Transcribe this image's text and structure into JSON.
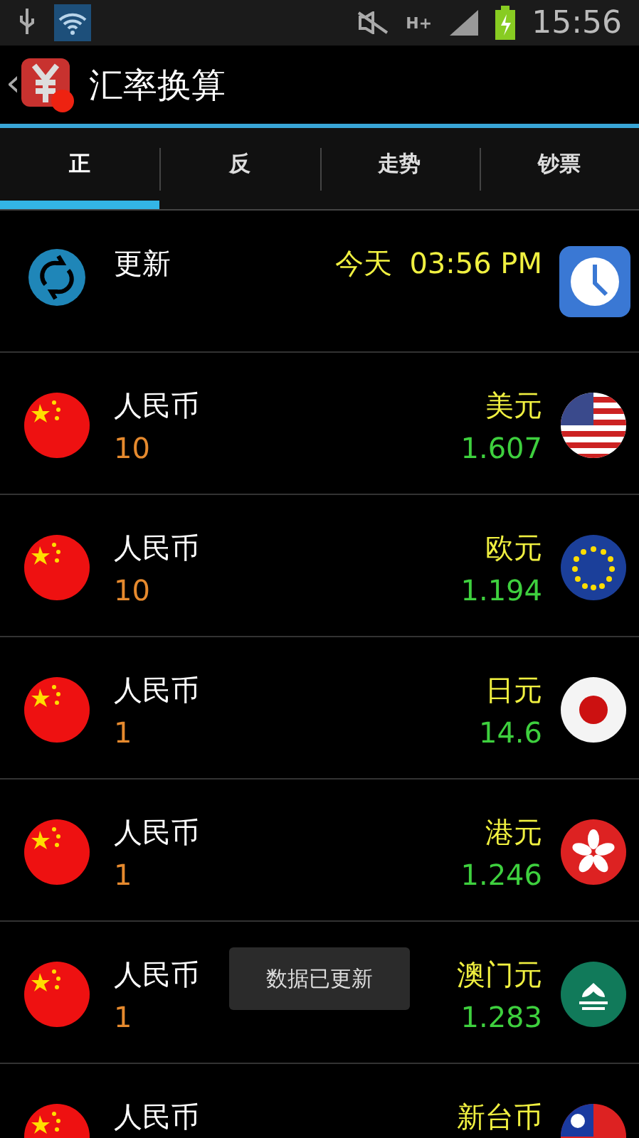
{
  "status_bar": {
    "time": "15:56",
    "network": "H+"
  },
  "action_bar": {
    "back": "‹",
    "title": "汇率换算"
  },
  "tabs": [
    {
      "label": "正",
      "selected": true
    },
    {
      "label": "反",
      "selected": false
    },
    {
      "label": "走势",
      "selected": false
    },
    {
      "label": "钞票",
      "selected": false
    }
  ],
  "update_row": {
    "label": "更新",
    "day": "今天",
    "time": "03:56 PM"
  },
  "rates": [
    {
      "from": "人民币",
      "amount": "10",
      "to": "美元",
      "rate": "1.607"
    },
    {
      "from": "人民币",
      "amount": "10",
      "to": "欧元",
      "rate": "1.194"
    },
    {
      "from": "人民币",
      "amount": "1",
      "to": "日元",
      "rate": "14.6"
    },
    {
      "from": "人民币",
      "amount": "1",
      "to": "港元",
      "rate": "1.246"
    },
    {
      "from": "人民币",
      "amount": "1",
      "to": "澳门元",
      "rate": "1.283"
    },
    {
      "from": "人民币",
      "to": "新台币"
    }
  ],
  "toast": "数据已更新"
}
